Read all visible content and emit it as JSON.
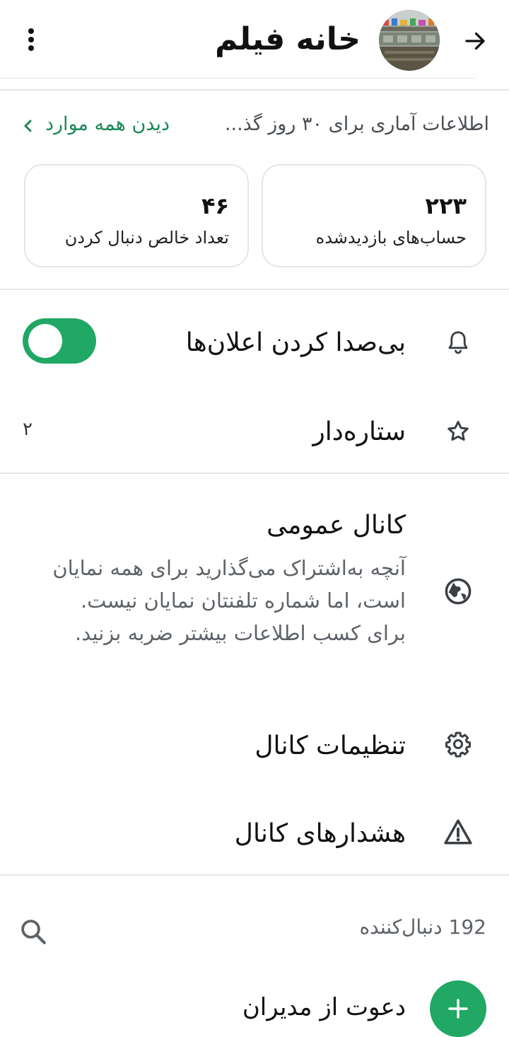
{
  "header": {
    "title": "خانه فیلم",
    "back_icon": "arrow-right-icon",
    "menu_icon": "more-vertical-icon"
  },
  "stats": {
    "description": "اطلاعات آماری برای ۳۰ روز گذ...",
    "see_all": "دیدن همه موارد",
    "cards": [
      {
        "value": "۲۲۳",
        "label": "حساب‌های بازدیدشده"
      },
      {
        "value": "۴۶",
        "label": "تعداد خالص دنبال کردن"
      }
    ]
  },
  "mute": {
    "label": "بی‌صدا کردن اعلان‌ها",
    "icon": "bell-icon",
    "enabled": true
  },
  "starred": {
    "label": "ستاره‌دار",
    "icon": "star-icon",
    "count": "۲"
  },
  "public_channel": {
    "title": "کانال عمومی",
    "description": "آنچه به‌اشتراک می‌گذارید برای همه نمایان است، اما شماره تلفنتان نمایان نیست. برای کسب اطلاعات بیشتر ضربه بزنید.",
    "icon": "globe-icon"
  },
  "channel_settings": {
    "label": "تنظیمات کانال",
    "icon": "gear-icon"
  },
  "channel_alerts": {
    "label": "هشدارهای کانال",
    "icon": "warning-icon"
  },
  "followers": {
    "label": "192 دنبال‌کننده",
    "icon": "search-icon"
  },
  "invite_admins": {
    "label": "دعوت از مدیران",
    "icon": "plus-icon"
  },
  "colors": {
    "accent": "#20a864",
    "link": "#1b8a57"
  }
}
